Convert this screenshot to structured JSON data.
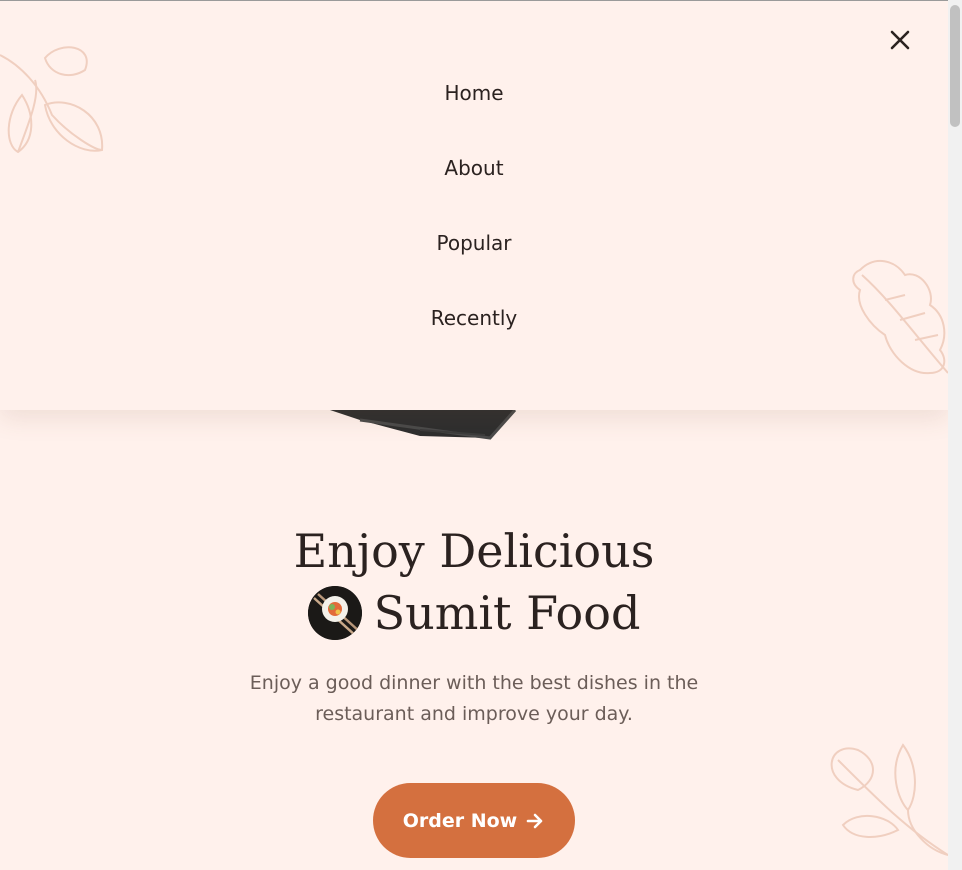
{
  "menu": {
    "close_label": "×",
    "items": [
      {
        "label": "Home"
      },
      {
        "label": "About"
      },
      {
        "label": "Popular"
      },
      {
        "label": "Recently"
      }
    ]
  },
  "hero": {
    "title_line1": "Enjoy Delicious",
    "title_line2": "Sumit Food",
    "description": "Enjoy a good dinner with the best dishes in the restaurant and improve your day.",
    "cta_label": "Order Now",
    "cta_icon": "arrow-right-icon"
  },
  "colors": {
    "background": "#fff1ec",
    "accent": "#d4703f",
    "text": "#2b2220",
    "muted_text": "#6b5d58",
    "leaf_outline": "#f0cfc0"
  }
}
